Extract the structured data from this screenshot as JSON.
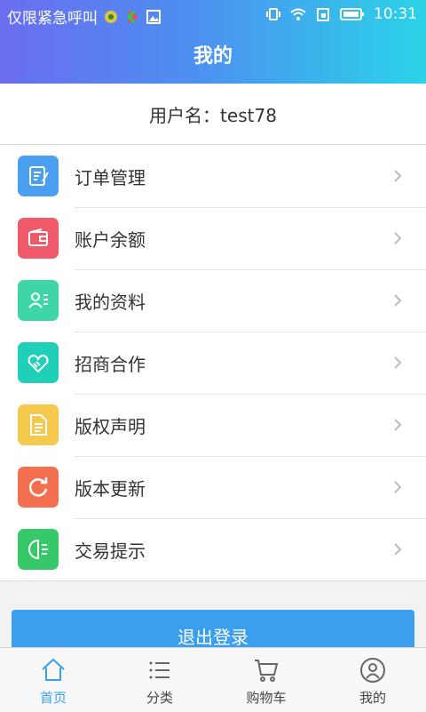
{
  "status_bar": {
    "carrier": "仅限紧急呼叫",
    "time": "10:31"
  },
  "header": {
    "title": "我的"
  },
  "user": {
    "label": "用户名：test78"
  },
  "menu": [
    {
      "label": "订单管理",
      "icon": "order-icon",
      "color": "#4a9ff0"
    },
    {
      "label": "账户余额",
      "icon": "wallet-icon",
      "color": "#ef5a6a"
    },
    {
      "label": "我的资料",
      "icon": "profile-icon",
      "color": "#3ed6a6"
    },
    {
      "label": "招商合作",
      "icon": "handshake-icon",
      "color": "#1fcfb8"
    },
    {
      "label": "版权声明",
      "icon": "document-icon",
      "color": "#f5c94d"
    },
    {
      "label": "版本更新",
      "icon": "refresh-icon",
      "color": "#f26f4f"
    },
    {
      "label": "交易提示",
      "icon": "notice-icon",
      "color": "#37c86a"
    }
  ],
  "logout_label": "退出登录",
  "tabs": [
    {
      "label": "首页",
      "icon": "home-icon",
      "active": true
    },
    {
      "label": "分类",
      "icon": "list-icon",
      "active": false
    },
    {
      "label": "购物车",
      "icon": "cart-icon",
      "active": false
    },
    {
      "label": "我的",
      "icon": "user-icon",
      "active": false
    }
  ],
  "colors": {
    "accent": "#3b9ff0"
  }
}
